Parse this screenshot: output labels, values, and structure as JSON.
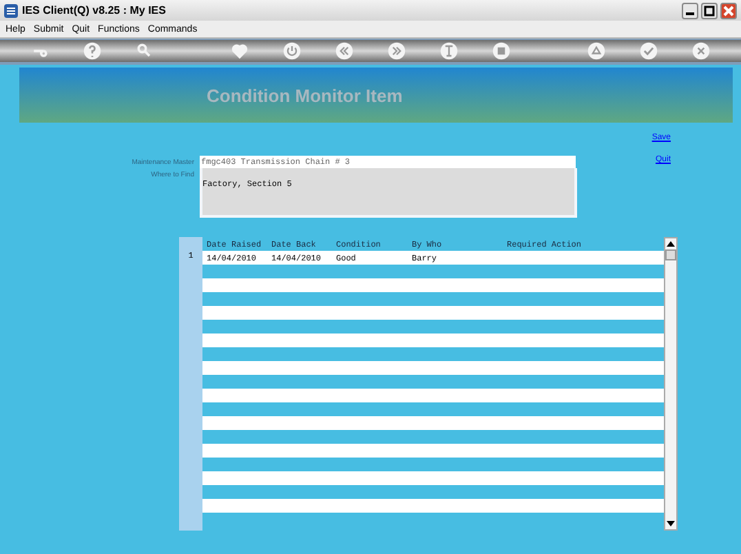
{
  "window": {
    "title": "IES Client(Q) v8.25 : My IES"
  },
  "menu": [
    "Help",
    "Submit",
    "Quit",
    "Functions",
    "Commands"
  ],
  "page": {
    "title": "Condition Monitor Item"
  },
  "links": [
    "Save",
    "Quit"
  ],
  "fields": [
    {
      "label": "Maintenance Master",
      "value": "fmgc403 Transmission Chain # 3",
      "kind": "line"
    },
    {
      "label": "Where to Find",
      "value": "Factory, Section 5",
      "kind": "area"
    }
  ],
  "table": {
    "columns": [
      "Date Raised",
      "Date Back",
      "Condition",
      "By Who",
      "Required Action"
    ],
    "rows": [
      {
        "number": "1",
        "cells": [
          "14/04/2010",
          "14/04/2010",
          "Good",
          "Barry",
          ""
        ]
      }
    ]
  }
}
